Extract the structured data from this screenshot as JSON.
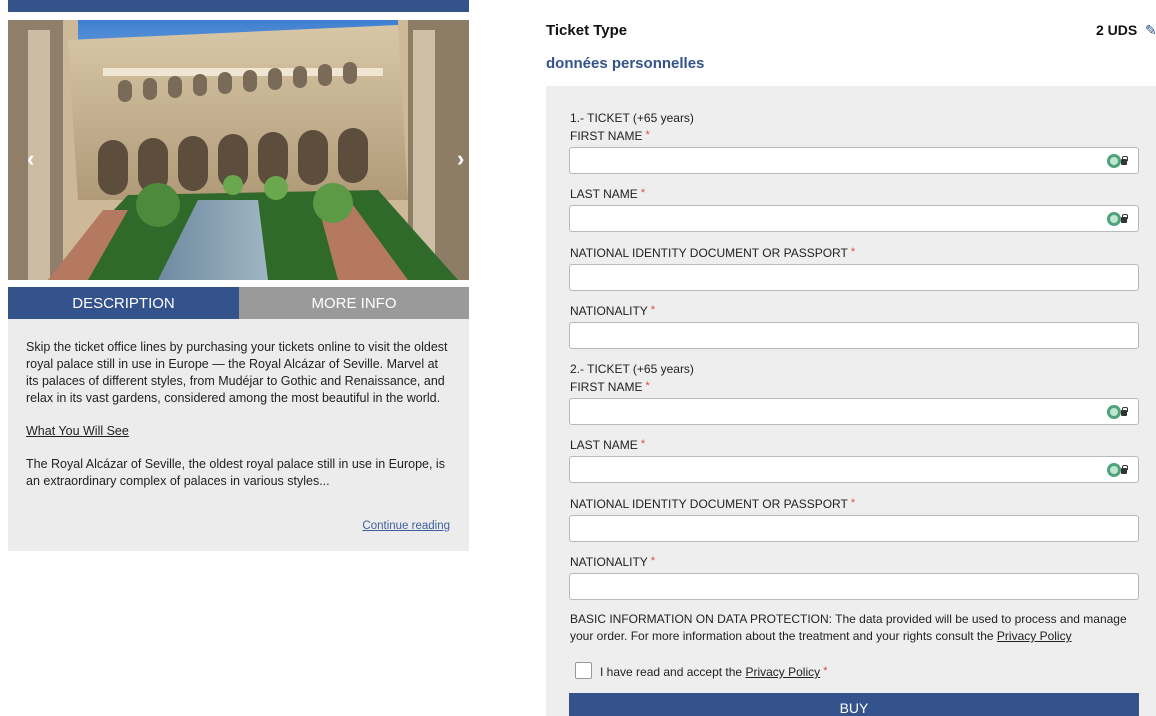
{
  "carousel": {
    "prev_glyph": "‹",
    "next_glyph": "›",
    "image": "royal-alcazar-courtyard"
  },
  "tabs": [
    {
      "label": "DESCRIPTION",
      "active": true
    },
    {
      "label": "MORE INFO",
      "active": false
    }
  ],
  "description": {
    "intro": "Skip the ticket office lines by purchasing your tickets online to visit the oldest royal palace still in use in Europe — the Royal Alcázar of Seville. Marvel at its palaces of different styles, from Mudéjar to Gothic and Renaissance, and relax in its vast gardens, considered among the most beautiful in the world.",
    "see_heading": "What You Will See",
    "see_text": "The Royal Alcázar of Seville, the oldest royal palace still in use in Europe, is an extraordinary complex of palaces in various styles...",
    "continue_label": "Continue reading"
  },
  "summary": {
    "ticket_type_label": "Ticket Type",
    "quantity": "2 UDS",
    "edit_icon": "pencil-icon"
  },
  "personal_title": "données personnelles",
  "form": {
    "tickets": [
      {
        "title": "1.- TICKET (+65 years)",
        "fields": [
          {
            "label": "FIRST NAME",
            "value": "",
            "password_manager_icon": true
          },
          {
            "label": "LAST NAME",
            "value": "",
            "password_manager_icon": true
          },
          {
            "label": "NATIONAL IDENTITY DOCUMENT OR PASSPORT",
            "value": "",
            "password_manager_icon": false
          },
          {
            "label": "NATIONALITY",
            "value": "",
            "password_manager_icon": false
          }
        ]
      },
      {
        "title": "2.- TICKET (+65 years)",
        "fields": [
          {
            "label": "FIRST NAME",
            "value": "",
            "password_manager_icon": true
          },
          {
            "label": "LAST NAME",
            "value": "",
            "password_manager_icon": true
          },
          {
            "label": "NATIONAL IDENTITY DOCUMENT OR PASSPORT",
            "value": "",
            "password_manager_icon": false
          },
          {
            "label": "NATIONALITY",
            "value": "",
            "password_manager_icon": false
          }
        ]
      }
    ],
    "required_mark": "*",
    "privacy_text": "BASIC INFORMATION ON DATA PROTECTION: The data provided will be used to process and manage your order. For more information about the treatment and your rights consult the",
    "privacy_link": "Privacy Policy",
    "accept_prefix": "I have read and accept the",
    "accept_link": "Privacy Policy",
    "accept_checked": false,
    "buy_label": "BUY"
  },
  "colors": {
    "brand_blue": "#34528c",
    "tab_inactive": "#9a9a9a",
    "panel_bg": "#eeeeee",
    "required_red": "#e04a3f"
  }
}
